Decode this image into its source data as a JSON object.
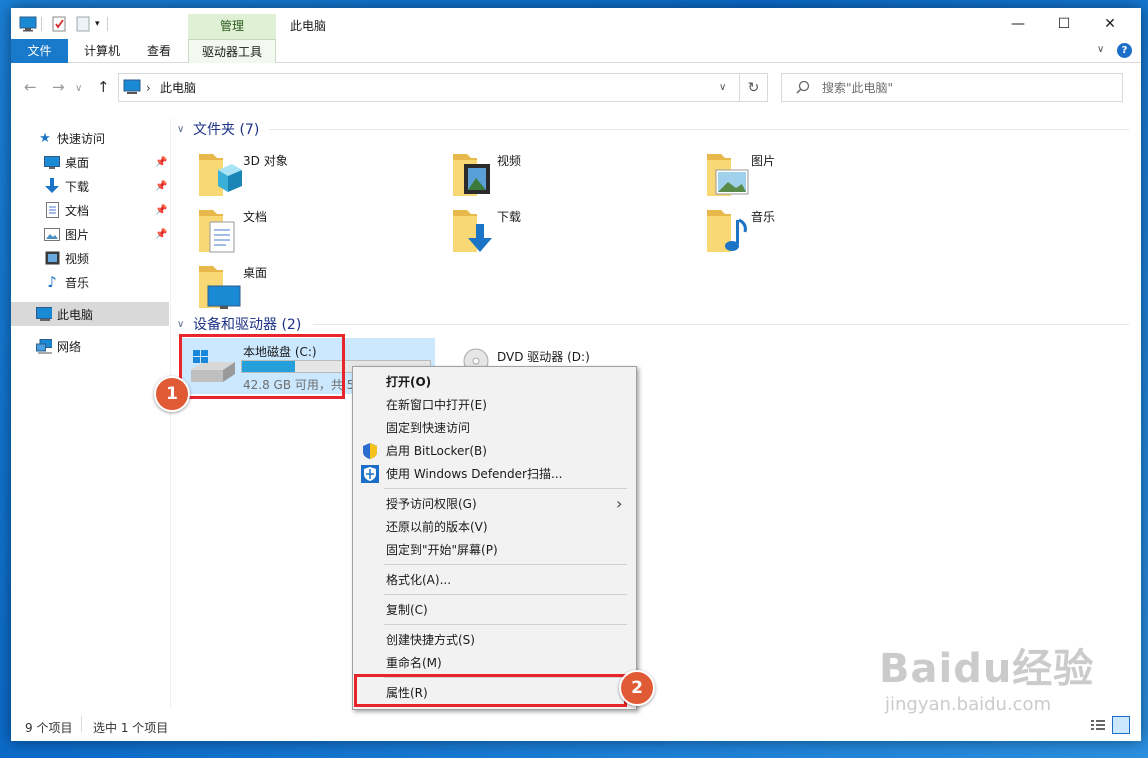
{
  "window": {
    "title": "此电脑",
    "context_tab": "管理"
  },
  "controls": {
    "minimize": "—",
    "maximize": "☐",
    "close": "✕"
  },
  "ribbon": {
    "tabs": [
      "文件",
      "计算机",
      "查看",
      "驱动器工具"
    ],
    "collapse": "∨",
    "help": "?"
  },
  "address": {
    "path_icon": "computer-icon",
    "separator": "›",
    "path": "此电脑",
    "dropdown": "∨",
    "refresh": "↻"
  },
  "search": {
    "placeholder": "搜索\"此电脑\""
  },
  "sidebar": {
    "items": [
      {
        "label": "快速访问",
        "icon": "star-icon",
        "pinned": false
      },
      {
        "label": "桌面",
        "icon": "desktop-icon",
        "pinned": true
      },
      {
        "label": "下载",
        "icon": "download-icon",
        "pinned": true
      },
      {
        "label": "文档",
        "icon": "document-icon",
        "pinned": true
      },
      {
        "label": "图片",
        "icon": "picture-icon",
        "pinned": true
      },
      {
        "label": "视频",
        "icon": "video-icon",
        "pinned": false
      },
      {
        "label": "音乐",
        "icon": "music-icon",
        "pinned": false
      },
      {
        "label": "此电脑",
        "icon": "computer-icon",
        "pinned": false,
        "selected": true
      },
      {
        "label": "网络",
        "icon": "network-icon",
        "pinned": false
      }
    ]
  },
  "folders_section": {
    "title": "文件夹 (7)",
    "folders": [
      {
        "name": "3D 对象",
        "overlay": "cube"
      },
      {
        "name": "视频",
        "overlay": "film"
      },
      {
        "name": "图片",
        "overlay": "picture"
      },
      {
        "name": "文档",
        "overlay": "doc"
      },
      {
        "name": "下载",
        "overlay": "arrow"
      },
      {
        "name": "音乐",
        "overlay": "note"
      },
      {
        "name": "桌面",
        "overlay": "screen"
      }
    ]
  },
  "devices_section": {
    "title": "设备和驱动器 (2)",
    "drive_c": {
      "name": "本地磁盘 (C:)",
      "free_text": "42.8 GB 可用，共 5",
      "used_fraction": 0.28
    },
    "drive_d": {
      "name": "DVD 驱动器 (D:)"
    }
  },
  "context_menu": {
    "items": [
      {
        "label": "打开(O)",
        "bold": true,
        "icon": ""
      },
      {
        "label": "在新窗口中打开(E)",
        "icon": ""
      },
      {
        "label": "固定到快速访问",
        "icon": ""
      },
      {
        "label": "启用 BitLocker(B)",
        "icon": "shield-icon"
      },
      {
        "label": "使用 Windows Defender扫描...",
        "icon": "defender-icon"
      },
      {
        "label": "授予访问权限(G)",
        "icon": "",
        "submenu": true
      },
      {
        "label": "还原以前的版本(V)",
        "icon": ""
      },
      {
        "label": "固定到\"开始\"屏幕(P)",
        "icon": ""
      },
      {
        "label": "格式化(A)...",
        "icon": ""
      },
      {
        "label": "复制(C)",
        "icon": ""
      },
      {
        "label": "创建快捷方式(S)",
        "icon": ""
      },
      {
        "label": "重命名(M)",
        "icon": ""
      },
      {
        "label": "属性(R)",
        "icon": ""
      }
    ],
    "submenu_arrow": "›"
  },
  "annotations": {
    "badge1": "1",
    "badge2": "2",
    "highlight_color": "#e8252a"
  },
  "status": {
    "item_count": "9 个项目",
    "selected": "选中 1 个项目"
  },
  "watermark": {
    "brand": "Baidu经验",
    "url": "jingyan.baidu.com"
  }
}
